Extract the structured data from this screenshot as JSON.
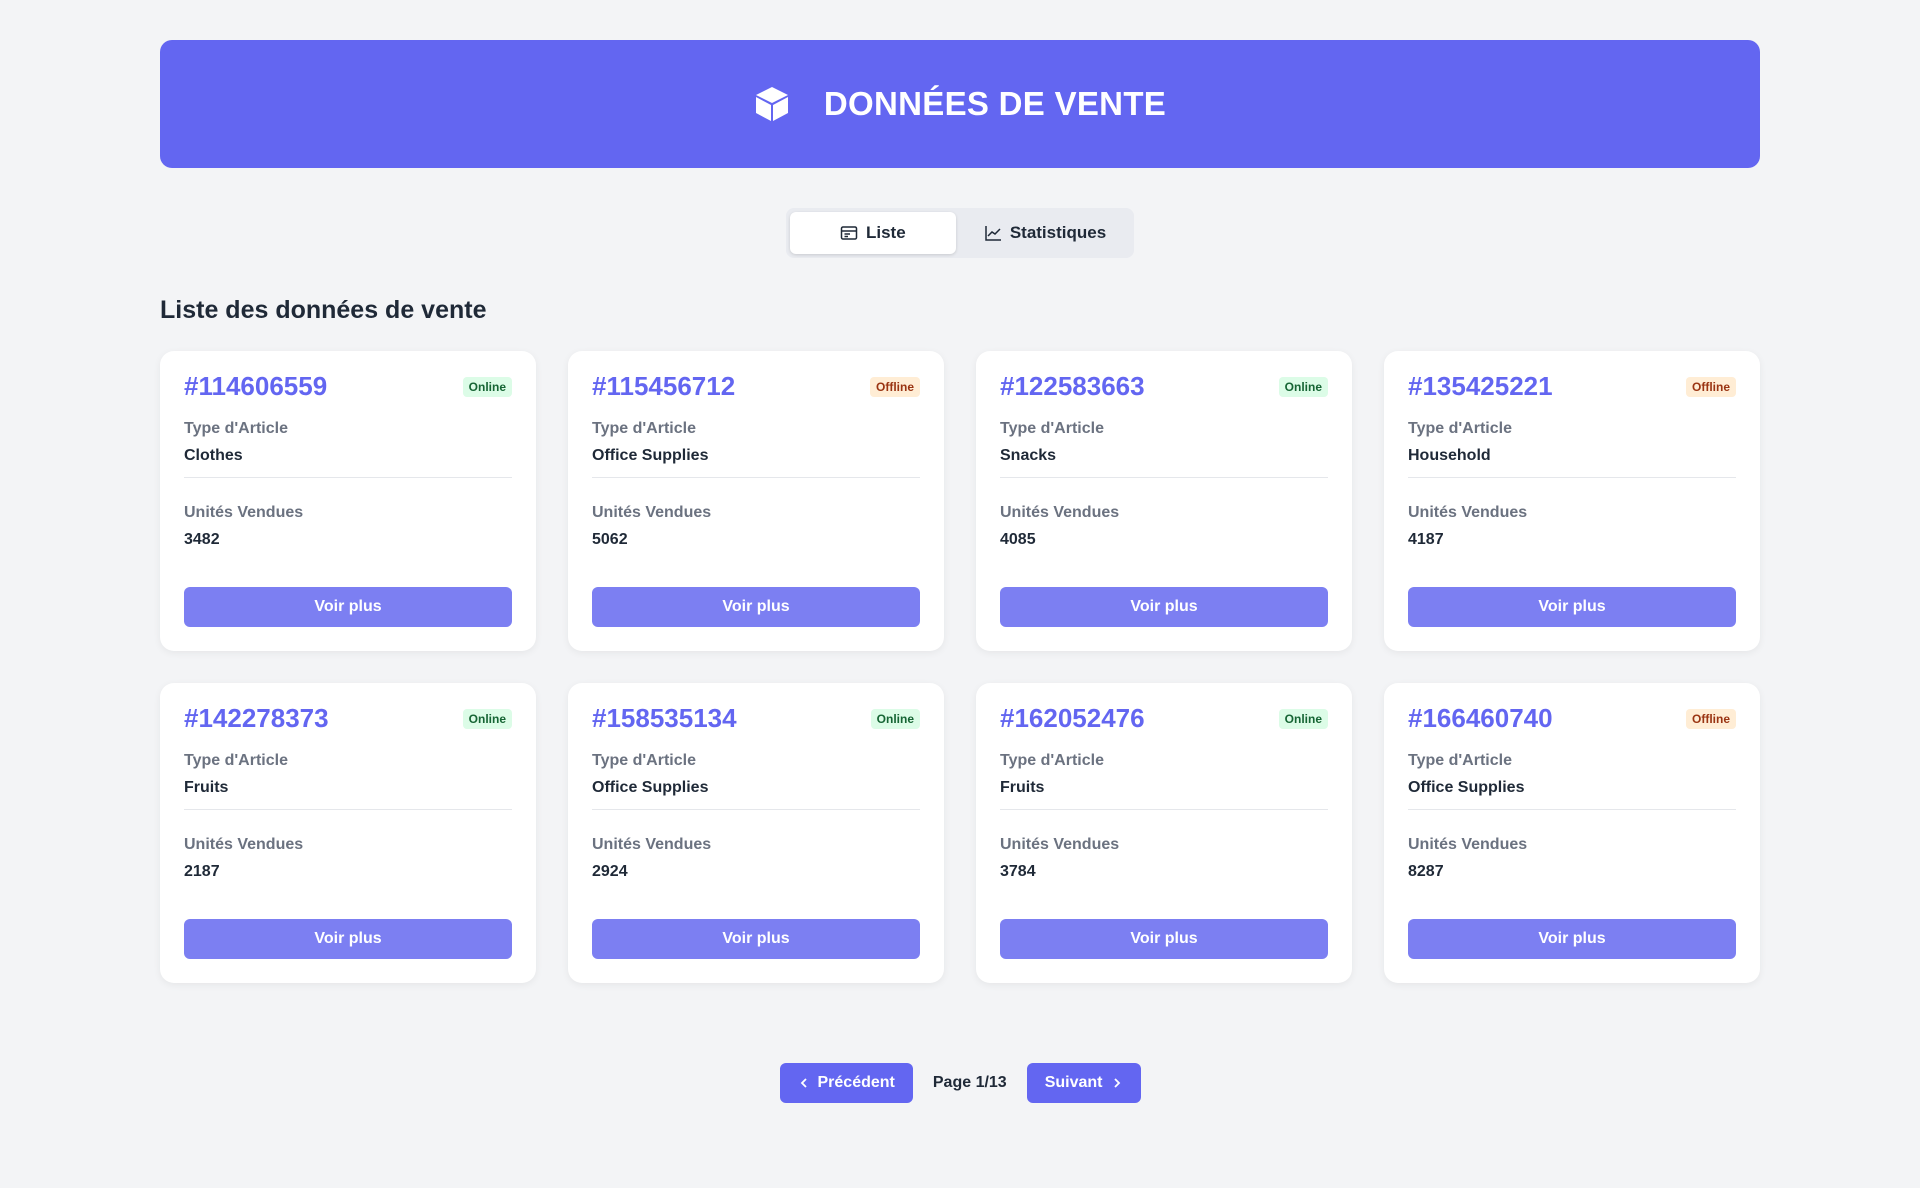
{
  "header": {
    "title": "DONNÉES DE VENTE",
    "icon": "cube-icon"
  },
  "tabs": [
    {
      "label": "Liste",
      "icon": "list-icon",
      "active": true
    },
    {
      "label": "Statistiques",
      "icon": "chart-line-icon",
      "active": false
    }
  ],
  "section_title": "Liste des données de vente",
  "labels": {
    "type": "Type d'Article",
    "units": "Unités Vendues",
    "more": "Voir plus"
  },
  "cards": [
    {
      "id": "#114606559",
      "status": "Online",
      "type": "Clothes",
      "units": "3482"
    },
    {
      "id": "#115456712",
      "status": "Offline",
      "type": "Office Supplies",
      "units": "5062"
    },
    {
      "id": "#122583663",
      "status": "Online",
      "type": "Snacks",
      "units": "4085"
    },
    {
      "id": "#135425221",
      "status": "Offline",
      "type": "Household",
      "units": "4187"
    },
    {
      "id": "#142278373",
      "status": "Online",
      "type": "Fruits",
      "units": "2187"
    },
    {
      "id": "#158535134",
      "status": "Online",
      "type": "Office Supplies",
      "units": "2924"
    },
    {
      "id": "#162052476",
      "status": "Online",
      "type": "Fruits",
      "units": "3784"
    },
    {
      "id": "#166460740",
      "status": "Offline",
      "type": "Office Supplies",
      "units": "8287"
    }
  ],
  "pagination": {
    "prev_label": "Précédent",
    "next_label": "Suivant",
    "page_info": "Page 1/13"
  },
  "colors": {
    "accent": "#6366f1",
    "button": "#7c7ff2",
    "online_bg": "#dcfce7",
    "offline_bg": "#ffedd5"
  }
}
